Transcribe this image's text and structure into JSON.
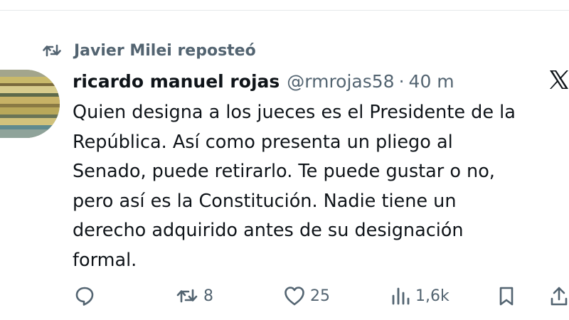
{
  "social_context": {
    "text": "Javier Milei reposteó",
    "icon": "repost-icon"
  },
  "tweet": {
    "author_name": "ricardo manuel rojas",
    "author_handle": "@rmrojas58",
    "separator": "·",
    "timestamp": "40 m",
    "body": "Quien designa a los jueces es el Presidente de la\nRepública. Así como presenta un pliego al\nSenado, puede retirarlo. Te puede gustar o no,\npero así es la Constitución. Nadie tiene un\nderecho adquirido antes de su designación\nformal."
  },
  "actions": {
    "reply": {
      "icon": "reply-icon"
    },
    "repost": {
      "icon": "repost-icon",
      "count": "8"
    },
    "like": {
      "icon": "heart-icon",
      "count": "25"
    },
    "views": {
      "icon": "views-icon",
      "count": "1,6k"
    },
    "bookmark": {
      "icon": "bookmark-icon"
    },
    "share": {
      "icon": "share-icon"
    }
  },
  "brand": {
    "logo": "x-logo-icon"
  },
  "colors": {
    "text": "#0f1419",
    "secondary": "#536471",
    "divider": "#e6e8ea"
  }
}
